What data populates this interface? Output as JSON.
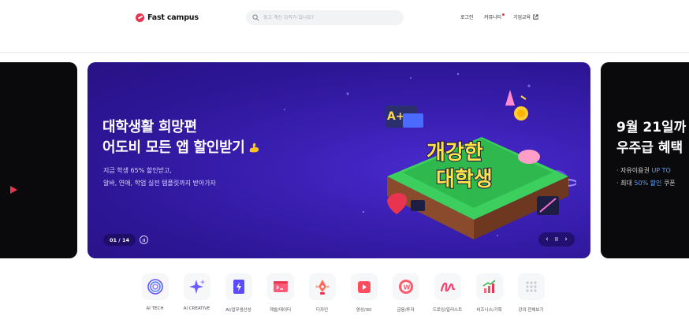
{
  "header": {
    "logo_text": "Fast campus",
    "search_placeholder": "찾고 계신 강의가 있나요?",
    "nav": {
      "login": "로그인",
      "community": "커뮤니티",
      "business": "기업교육"
    }
  },
  "banner": {
    "title_lines": [
      "대학생활 희망편",
      "어도비 모든 앱 할인받기"
    ],
    "desc_lines": [
      "지금 학생 65% 할인받고,",
      "알바, 연애, 학업 실전 템플릿까지 받아가자"
    ],
    "counter": "01 / 14",
    "prev_symbol": "‹",
    "pause_symbol": "II",
    "next_symbol": "›",
    "art_text_1": "개강한",
    "art_text_2": "대학생",
    "art_badge": "A+"
  },
  "next_banner": {
    "title_lines": [
      "9월 21일까",
      "우주급 혜택"
    ],
    "desc_line_1_prefix": "· 자유이용권 ",
    "desc_line_1_highlight": "UP TO",
    "desc_line_2_prefix": "· 최대 ",
    "desc_line_2_highlight": "50% 할인",
    "desc_line_2_suffix": " 쿠폰"
  },
  "categories": [
    {
      "label": "AI TECH",
      "icon": "ai-tech-icon"
    },
    {
      "label": "AI CREATIVE",
      "icon": "sparkle-icon"
    },
    {
      "label": "AI/업무생산성",
      "icon": "lightning-document-icon"
    },
    {
      "label": "개발/데이터",
      "icon": "terminal-icon"
    },
    {
      "label": "디자인",
      "icon": "pen-tool-icon"
    },
    {
      "label": "영상/3D",
      "icon": "video-play-icon"
    },
    {
      "label": "금융/투자",
      "icon": "coin-icon"
    },
    {
      "label": "드로잉/일러스트",
      "icon": "brush-stroke-icon"
    },
    {
      "label": "비즈니스/기획",
      "icon": "growth-chart-icon"
    },
    {
      "label": "강의 전체보기",
      "icon": "grid-dots-icon"
    }
  ],
  "colors": {
    "brand": "#e8344e",
    "banner_bg": "#2d1696",
    "accent_blue": "#5ea1ff"
  }
}
